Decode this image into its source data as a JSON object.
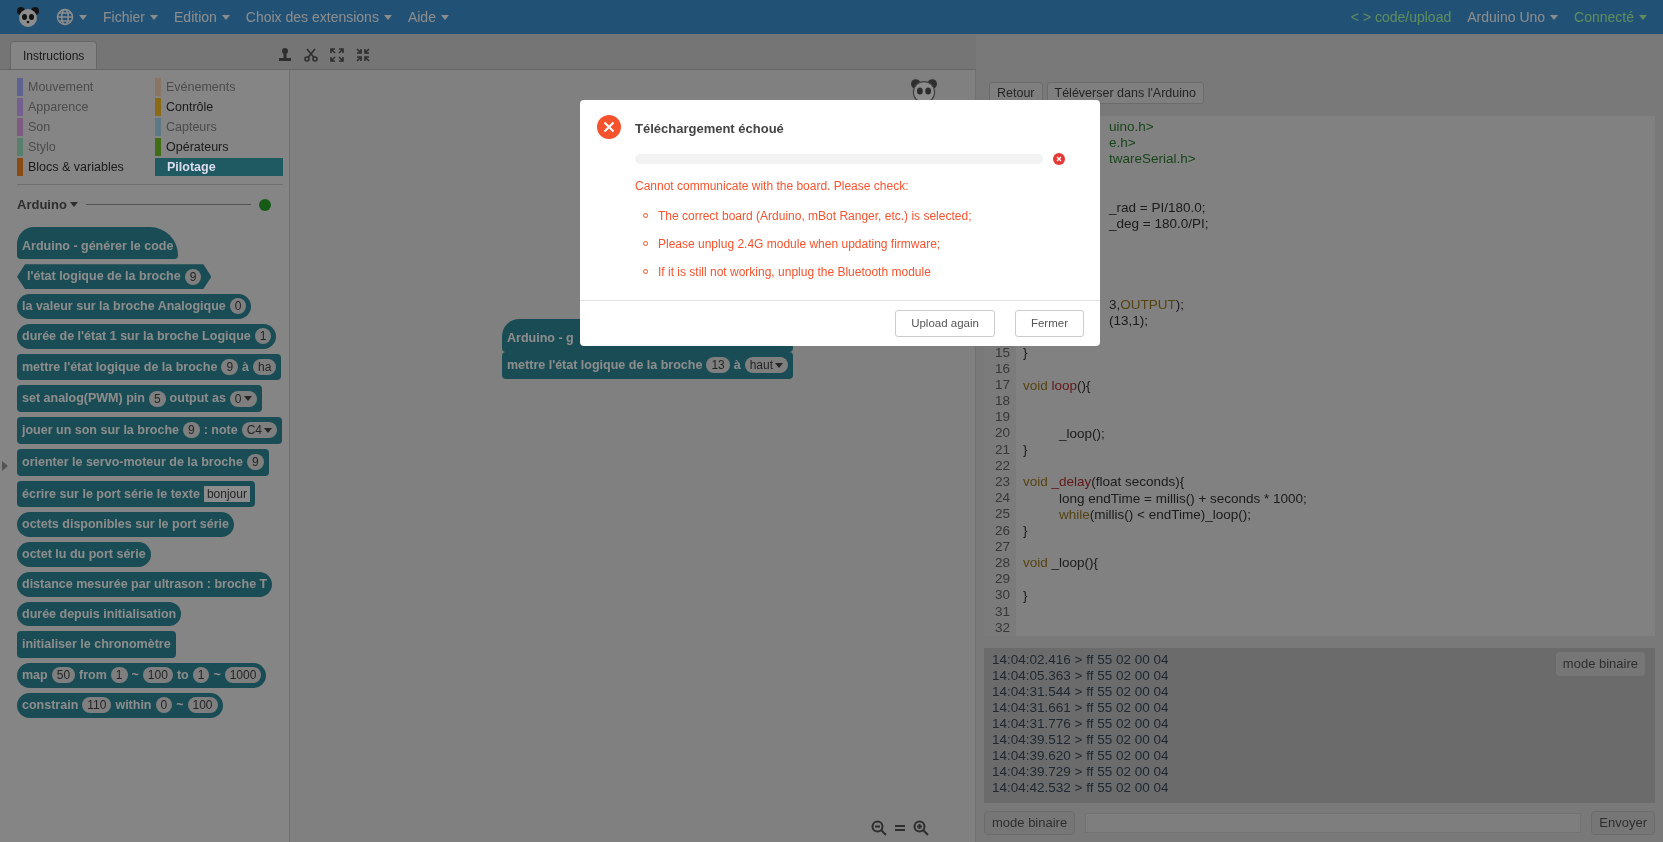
{
  "top_bar": {
    "menus": [
      "Fichier",
      "Edition",
      "Choix des extensions",
      "Aide"
    ],
    "code_link": "< > code/upload",
    "board": "Arduino Uno",
    "connection": "Connecté"
  },
  "tabs": [
    {
      "label": "Instructions",
      "selected": true
    }
  ],
  "categories": [
    {
      "label": "Mouvement",
      "color": "#5d6290",
      "disabled": true,
      "selected": false
    },
    {
      "label": "Evénements",
      "color": "#8a7565",
      "disabled": true,
      "selected": false
    },
    {
      "label": "Apparence",
      "color": "#74608e",
      "disabled": true,
      "selected": false
    },
    {
      "label": "Contrôle",
      "color": "#8a6a14",
      "disabled": false,
      "selected": false
    },
    {
      "label": "Son",
      "color": "#7e5c82",
      "disabled": true,
      "selected": false
    },
    {
      "label": "Capteurs",
      "color": "#5d7886",
      "disabled": true,
      "selected": false
    },
    {
      "label": "Stylo",
      "color": "#5a7e6e",
      "disabled": true,
      "selected": false
    },
    {
      "label": "Opérateurs",
      "color": "#3f6e16",
      "disabled": false,
      "selected": false
    },
    {
      "label": "Blocs & variables",
      "color": "#8a4c14",
      "disabled": false,
      "selected": false
    },
    {
      "label": "Pilotage",
      "color": "#1f5a63",
      "disabled": false,
      "selected": true
    }
  ],
  "palette": {
    "heading": "Arduino",
    "connected": true,
    "blocks": [
      {
        "kind": "hat",
        "parts": [
          {
            "kind": "text",
            "text": "Arduino - générer le code"
          }
        ]
      },
      {
        "kind": "boolean",
        "parts": [
          {
            "kind": "text",
            "text": "l'état logique de la broche"
          },
          {
            "kind": "number",
            "text": "9"
          }
        ]
      },
      {
        "kind": "reporter",
        "parts": [
          {
            "kind": "text",
            "text": "la valeur sur la broche Analogique"
          },
          {
            "kind": "number",
            "text": "0"
          }
        ]
      },
      {
        "kind": "reporter",
        "parts": [
          {
            "kind": "text",
            "text": "durée de l'état 1 sur la broche Logique"
          },
          {
            "kind": "number",
            "text": "1"
          }
        ]
      },
      {
        "kind": "command",
        "parts": [
          {
            "kind": "text",
            "text": "mettre l'état logique de la broche"
          },
          {
            "kind": "number",
            "text": "9"
          },
          {
            "kind": "text",
            "text": "à"
          },
          {
            "kind": "number",
            "text": "ha"
          }
        ]
      },
      {
        "kind": "command",
        "parts": [
          {
            "kind": "text",
            "text": "set analog(PWM) pin"
          },
          {
            "kind": "number",
            "text": "5"
          },
          {
            "kind": "text",
            "text": "output as"
          },
          {
            "kind": "dropdown",
            "text": "0"
          }
        ]
      },
      {
        "kind": "command",
        "parts": [
          {
            "kind": "text",
            "text": "jouer un son sur la broche"
          },
          {
            "kind": "number",
            "text": "9"
          },
          {
            "kind": "text",
            "text": ": note"
          },
          {
            "kind": "dropdown",
            "text": "C4"
          }
        ]
      },
      {
        "kind": "command",
        "parts": [
          {
            "kind": "text",
            "text": "orienter le servo-moteur de la broche"
          },
          {
            "kind": "number",
            "text": "9"
          }
        ]
      },
      {
        "kind": "command",
        "parts": [
          {
            "kind": "text",
            "text": "écrire sur le port série le texte"
          },
          {
            "kind": "textfield",
            "text": "bonjour"
          }
        ]
      },
      {
        "kind": "reporter",
        "parts": [
          {
            "kind": "text",
            "text": "octets disponibles sur le port série"
          }
        ]
      },
      {
        "kind": "reporter",
        "parts": [
          {
            "kind": "text",
            "text": "octet lu du port série"
          }
        ]
      },
      {
        "kind": "reporter",
        "parts": [
          {
            "kind": "text",
            "text": "distance mesurée par ultrason : broche T"
          }
        ]
      },
      {
        "kind": "reporter",
        "parts": [
          {
            "kind": "text",
            "text": "durée depuis initialisation"
          }
        ]
      },
      {
        "kind": "command",
        "parts": [
          {
            "kind": "text",
            "text": "initialiser le chronomètre"
          }
        ]
      },
      {
        "kind": "reporter",
        "parts": [
          {
            "kind": "text",
            "text": "map"
          },
          {
            "kind": "number",
            "text": "50"
          },
          {
            "kind": "text",
            "text": "from"
          },
          {
            "kind": "number",
            "text": "1"
          },
          {
            "kind": "text",
            "text": "~"
          },
          {
            "kind": "number",
            "text": "100"
          },
          {
            "kind": "text",
            "text": "to"
          },
          {
            "kind": "number",
            "text": "1"
          },
          {
            "kind": "text",
            "text": "~"
          },
          {
            "kind": "number",
            "text": "1000"
          }
        ]
      },
      {
        "kind": "reporter",
        "parts": [
          {
            "kind": "text",
            "text": "constrain"
          },
          {
            "kind": "number",
            "text": "110"
          },
          {
            "kind": "text",
            "text": "within"
          },
          {
            "kind": "number",
            "text": "0"
          },
          {
            "kind": "text",
            "text": "~"
          },
          {
            "kind": "number",
            "text": "100"
          }
        ]
      }
    ]
  },
  "canvas": {
    "script": [
      {
        "kind": "hat",
        "parts": [
          {
            "kind": "text",
            "text": "Arduino - g"
          }
        ]
      },
      {
        "kind": "command",
        "parts": [
          {
            "kind": "text",
            "text": "mettre l'état logique de la broche"
          },
          {
            "kind": "number",
            "text": "13"
          },
          {
            "kind": "text",
            "text": "à"
          },
          {
            "kind": "dropdown",
            "text": "haut"
          }
        ]
      }
    ]
  },
  "code_panel": {
    "buttons": [
      "Retour",
      "Téléverser dans l'Arduino"
    ],
    "lines": [
      {
        "kind": "code",
        "tokens": [
          {
            "kind": "string",
            "text": "uino.h>"
          }
        ]
      },
      {
        "kind": "code",
        "tokens": [
          {
            "kind": "string",
            "text": "e.h>"
          }
        ]
      },
      {
        "kind": "code",
        "tokens": [
          {
            "kind": "string",
            "text": "twareSerial.h>"
          }
        ]
      },
      {
        "kind": "blank"
      },
      {
        "kind": "blank"
      },
      {
        "kind": "code",
        "tokens": [
          {
            "kind": "plain",
            "text": "_rad = PI/180.0;"
          }
        ]
      },
      {
        "kind": "code",
        "tokens": [
          {
            "kind": "plain",
            "text": "_deg = 180.0/PI;"
          }
        ]
      },
      {
        "kind": "blank"
      },
      {
        "kind": "blank"
      },
      {
        "kind": "blank"
      },
      {
        "kind": "blank"
      },
      {
        "kind": "code",
        "tokens": [
          {
            "kind": "plain",
            "text": "3,"
          },
          {
            "kind": "keyword",
            "text": "OUTPUT"
          },
          {
            "kind": "plain",
            "text": ");"
          }
        ]
      },
      {
        "kind": "code",
        "tokens": [
          {
            "kind": "plain",
            "text": "(13,1);"
          }
        ]
      },
      {
        "kind": "blank"
      },
      {
        "kind": "code",
        "number": "15",
        "tokens": [
          {
            "kind": "plain",
            "text": "}"
          }
        ]
      },
      {
        "kind": "code",
        "number": "16"
      },
      {
        "kind": "code",
        "number": "17",
        "tokens": [
          {
            "kind": "keyword",
            "text": "void"
          },
          {
            "kind": "function",
            "text": " loop"
          },
          {
            "kind": "plain",
            "text": "(){"
          }
        ]
      },
      {
        "kind": "code",
        "number": "18"
      },
      {
        "kind": "code",
        "number": "19"
      },
      {
        "kind": "code",
        "number": "20",
        "indented": true,
        "tokens": [
          {
            "kind": "plain",
            "text": "_loop();"
          }
        ]
      },
      {
        "kind": "code",
        "number": "21",
        "tokens": [
          {
            "kind": "plain",
            "text": "}"
          }
        ]
      },
      {
        "kind": "code",
        "number": "22"
      },
      {
        "kind": "code",
        "number": "23",
        "tokens": [
          {
            "kind": "keyword",
            "text": "void"
          },
          {
            "kind": "function",
            "text": " _delay"
          },
          {
            "kind": "plain",
            "text": "(float seconds){"
          }
        ]
      },
      {
        "kind": "code",
        "number": "24",
        "indented": true,
        "tokens": [
          {
            "kind": "plain",
            "text": "long endTime = millis() + seconds * 1000;"
          }
        ]
      },
      {
        "kind": "code",
        "number": "25",
        "indented": true,
        "tokens": [
          {
            "kind": "keyword",
            "text": "while"
          },
          {
            "kind": "plain",
            "text": "(millis() < endTime)_loop();"
          }
        ]
      },
      {
        "kind": "code",
        "number": "26",
        "tokens": [
          {
            "kind": "plain",
            "text": "}"
          }
        ]
      },
      {
        "kind": "code",
        "number": "27"
      },
      {
        "kind": "code",
        "number": "28",
        "tokens": [
          {
            "kind": "keyword",
            "text": "void"
          },
          {
            "kind": "plain",
            "text": " _loop(){"
          }
        ]
      },
      {
        "kind": "code",
        "number": "29"
      },
      {
        "kind": "code",
        "number": "30",
        "tokens": [
          {
            "kind": "plain",
            "text": "}"
          }
        ]
      },
      {
        "kind": "code",
        "number": "31"
      },
      {
        "kind": "code",
        "number": "32"
      }
    ]
  },
  "serial": {
    "log": [
      "14:04:02.416 > ff 55 02 00 04",
      "14:04:05.363 > ff 55 02 00 04",
      "14:04:31.544 > ff 55 02 00 04",
      "14:04:31.661 > ff 55 02 00 04",
      "14:04:31.776 > ff 55 02 00 04",
      "14:04:39.512 > ff 55 02 00 04",
      "14:04:39.620 > ff 55 02 00 04",
      "14:04:39.729 > ff 55 02 00 04",
      "14:04:42.532 > ff 55 02 00 04"
    ],
    "log_button": "mode binaire",
    "mode_button": "mode binaire",
    "send_button": "Envoyer"
  },
  "dialog": {
    "title": "Téléchargement échoué",
    "progress": {
      "level": 0
    },
    "message": "Cannot communicate with the board. Please check:",
    "checks": [
      "The correct board (Arduino, mBot Ranger, etc.) is selected;",
      "Please unplug 2.4G module when updating firmware;",
      "If it is still not working, unplug the Bluetooth module"
    ],
    "buttons": [
      "Upload again",
      "Fermer"
    ]
  }
}
